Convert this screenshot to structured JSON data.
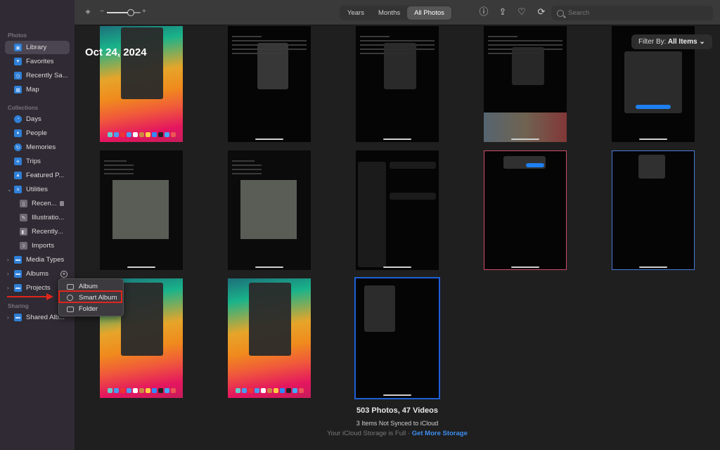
{
  "sidebar": {
    "sections": {
      "photos": "Photos",
      "collections": "Collections",
      "sharing": "Sharing"
    },
    "photos_items": [
      {
        "label": "Library",
        "icon": "library-icon",
        "selected": true
      },
      {
        "label": "Favorites",
        "icon": "heart-icon"
      },
      {
        "label": "Recently Sa...",
        "icon": "recently-saved-icon"
      },
      {
        "label": "Map",
        "icon": "map-icon"
      }
    ],
    "collections_items": [
      {
        "label": "Days",
        "icon": "days-icon"
      },
      {
        "label": "People",
        "icon": "people-icon"
      },
      {
        "label": "Memories",
        "icon": "memories-icon"
      },
      {
        "label": "Trips",
        "icon": "trips-icon"
      },
      {
        "label": "Featured P...",
        "icon": "featured-photos-icon"
      }
    ],
    "utilities": {
      "label": "Utilities",
      "items": [
        {
          "label": "Recen...",
          "icon": "recently-deleted-icon",
          "locked": true
        },
        {
          "label": "Illustratio...",
          "icon": "illustrations-icon"
        },
        {
          "label": "Recently...",
          "icon": "recently-edited-icon"
        },
        {
          "label": "Imports",
          "icon": "imports-icon"
        }
      ]
    },
    "media_types": "Media Types",
    "albums": "Albums",
    "projects": "Projects",
    "shared_albums": "Shared Alb..."
  },
  "toolbar": {
    "view_tabs": [
      "Years",
      "Months",
      "All Photos"
    ],
    "active_tab": "All Photos",
    "zoom_level": 0.7,
    "search_placeholder": "Search"
  },
  "grid": {
    "date_label": "Oct 24, 2024",
    "filter_label": "Filter By:",
    "filter_value": "All Items",
    "filter_chevron": "⌄"
  },
  "context_menu": {
    "items": [
      "Album",
      "Smart Album",
      "Folder"
    ],
    "highlighted": "Smart Album"
  },
  "summary": {
    "count": "503 Photos, 47 Videos",
    "sync_status": "3 Items Not Synced to iCloud",
    "storage_text": "Your iCloud Storage is Full · ",
    "storage_link": "Get More Storage"
  },
  "colors": {
    "accent": "#2f7fd6",
    "highlight": "#e0261c",
    "link": "#3d8ef0"
  }
}
